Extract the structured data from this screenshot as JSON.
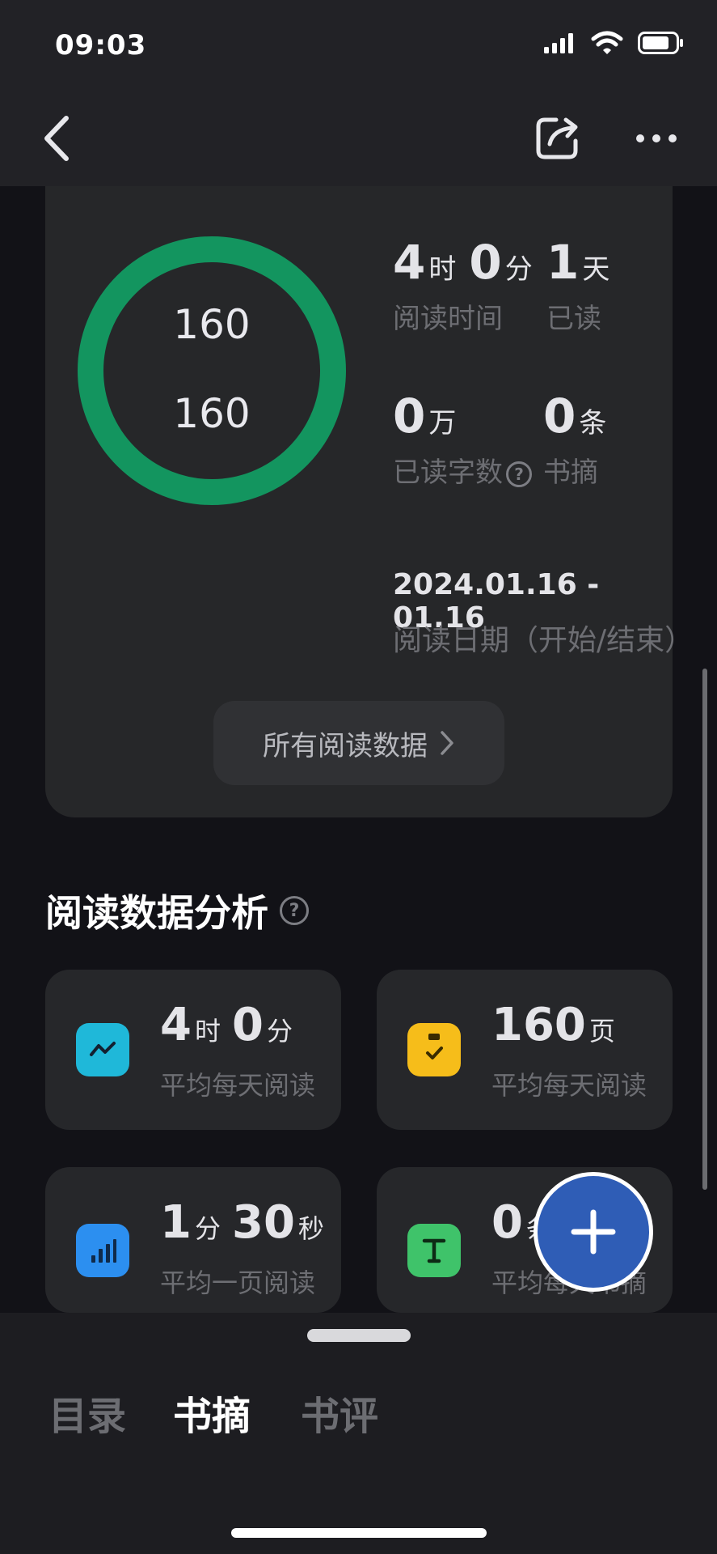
{
  "status_bar": {
    "time": "09:03"
  },
  "nav": {
    "back": "back",
    "share": "share",
    "more": "more"
  },
  "summary": {
    "ring": {
      "top_value": "160",
      "bottom_value": "160",
      "progress": 1.0,
      "color": "#13955f"
    },
    "stats": [
      {
        "num": "4",
        "unit": "时",
        "num2": "0",
        "unit2": "分",
        "label": "阅读时间"
      },
      {
        "num": "1",
        "unit": "天",
        "label": "已读"
      },
      {
        "num": "0",
        "unit": "万",
        "label": "已读字数"
      },
      {
        "num": "0",
        "unit": "条",
        "label": "书摘"
      }
    ],
    "date_value": "2024.01.16 - 01.16",
    "date_label": "阅读日期（开始/结束）",
    "all_data_button": "所有阅读数据"
  },
  "analysis": {
    "title": "阅读数据分析",
    "tiles": [
      {
        "icon": "trend-line-icon",
        "color": "#1fb8d9",
        "num": "4",
        "unit": "时",
        "num2": "0",
        "unit2": "分",
        "label": "平均每天阅读"
      },
      {
        "icon": "clipboard-check-icon",
        "color": "#f6bd1a",
        "num": "160",
        "unit": "页",
        "label": "平均每天阅读"
      },
      {
        "icon": "bar-chart-icon",
        "color": "#2c8ff0",
        "num": "1",
        "unit": "分",
        "num2": "30",
        "unit2": "秒",
        "label": "平均一页阅读"
      },
      {
        "icon": "text-t-icon",
        "color": "#3fc36a",
        "num": "0",
        "unit": "条",
        "label": "平均每天书摘"
      }
    ]
  },
  "tabs": [
    {
      "label": "目录",
      "active": false
    },
    {
      "label": "书摘",
      "active": true
    },
    {
      "label": "书评",
      "active": false
    }
  ]
}
